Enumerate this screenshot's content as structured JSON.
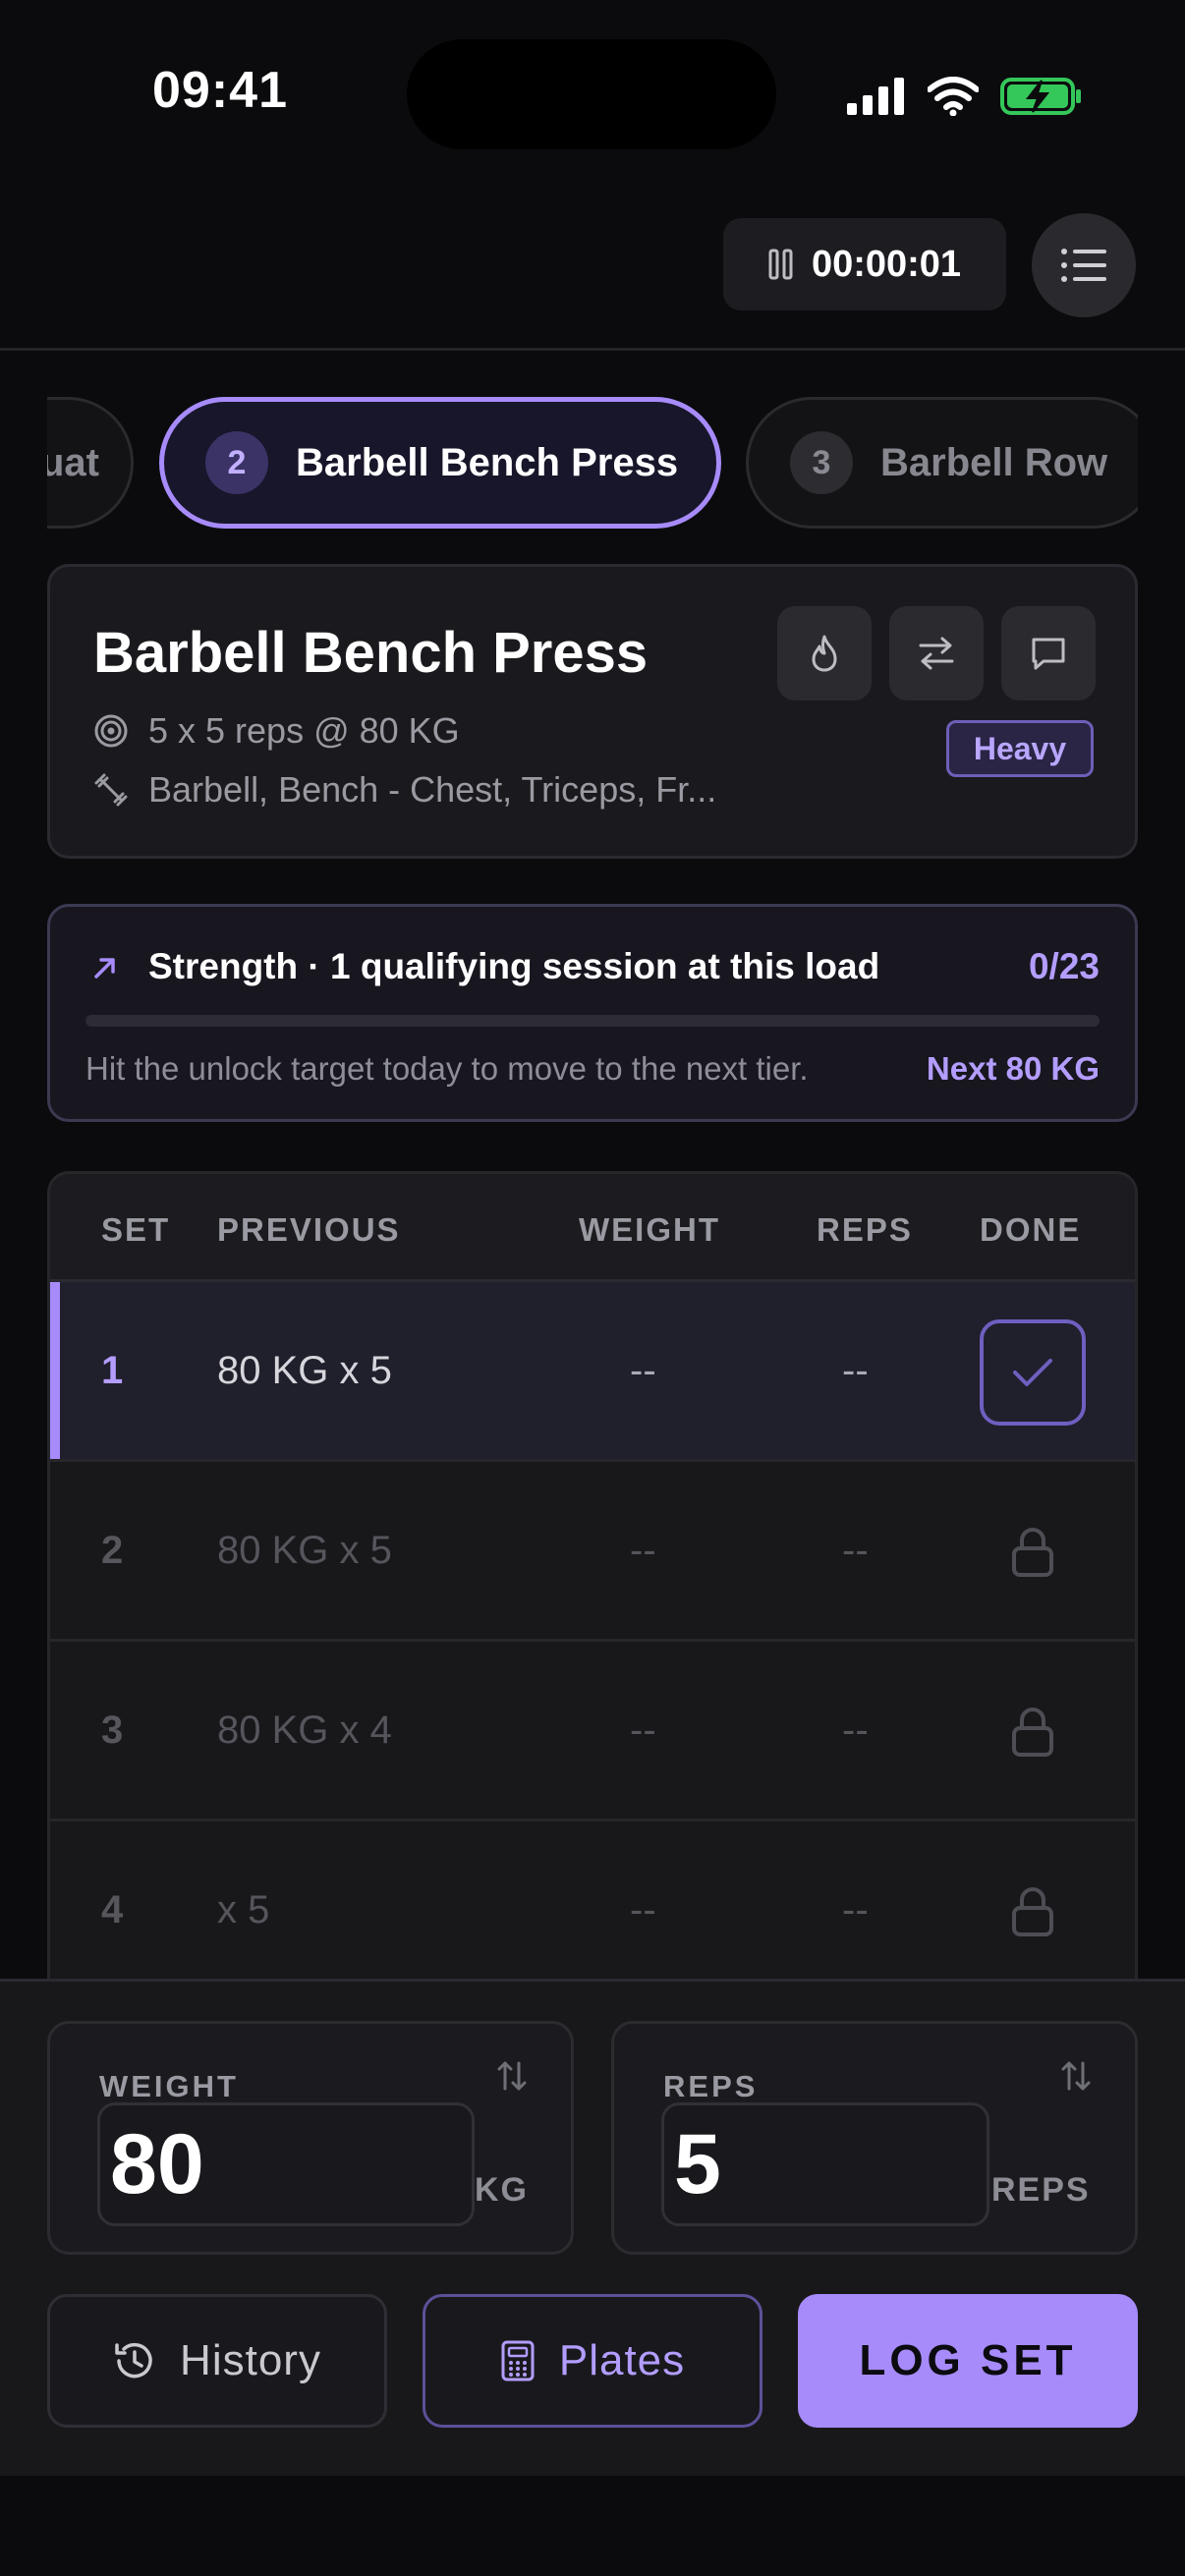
{
  "status_bar": {
    "time": "09:41",
    "icons": [
      "signal-icon",
      "wifi-icon",
      "battery-charging-icon"
    ],
    "battery_color": "#34c759"
  },
  "top_bar": {
    "timer": "00:00:01",
    "timer_icon": "pause-icon",
    "menu_icon": "list-icon"
  },
  "exercise_tabs": [
    {
      "number": "",
      "label": "uat",
      "active": false
    },
    {
      "number": "2",
      "label": "Barbell Bench Press",
      "active": true
    },
    {
      "number": "3",
      "label": "Barbell Row",
      "active": false
    }
  ],
  "exercise": {
    "title": "Barbell Bench Press",
    "target": "5 x 5 reps @ 80 KG",
    "equipment": "Barbell, Bench - Chest, Triceps, Fr...",
    "intensity_badge": "Heavy",
    "actions": [
      "flame-icon",
      "swap-icon",
      "comment-icon"
    ]
  },
  "progression": {
    "title": "Strength · 1 qualifying session at this load",
    "count": "0/23",
    "progress": 0,
    "hint": "Hit the unlock target today to move to the next tier.",
    "next": "Next 80 KG"
  },
  "sets_table": {
    "headers": {
      "set": "SET",
      "previous": "PREVIOUS",
      "weight": "WEIGHT",
      "reps": "REPS",
      "done": "DONE"
    },
    "rows": [
      {
        "set": "1",
        "previous": "80 KG x 5",
        "weight": "--",
        "reps": "--",
        "state": "current"
      },
      {
        "set": "2",
        "previous": "80 KG x 5",
        "weight": "--",
        "reps": "--",
        "state": "locked"
      },
      {
        "set": "3",
        "previous": "80 KG x 4",
        "weight": "--",
        "reps": "--",
        "state": "locked"
      },
      {
        "set": "4",
        "previous": "x 5",
        "weight": "--",
        "reps": "--",
        "state": "locked"
      }
    ]
  },
  "inputs": {
    "weight": {
      "label": "WEIGHT",
      "value": "80",
      "unit": "KG"
    },
    "reps": {
      "label": "REPS",
      "value": "5",
      "unit": "REPS"
    }
  },
  "buttons": {
    "history": "History",
    "plates": "Plates",
    "log_set": "LOG SET"
  },
  "colors": {
    "accent": "#a78bfa",
    "background": "#0b0b0e",
    "surface": "#1a1a1e"
  }
}
